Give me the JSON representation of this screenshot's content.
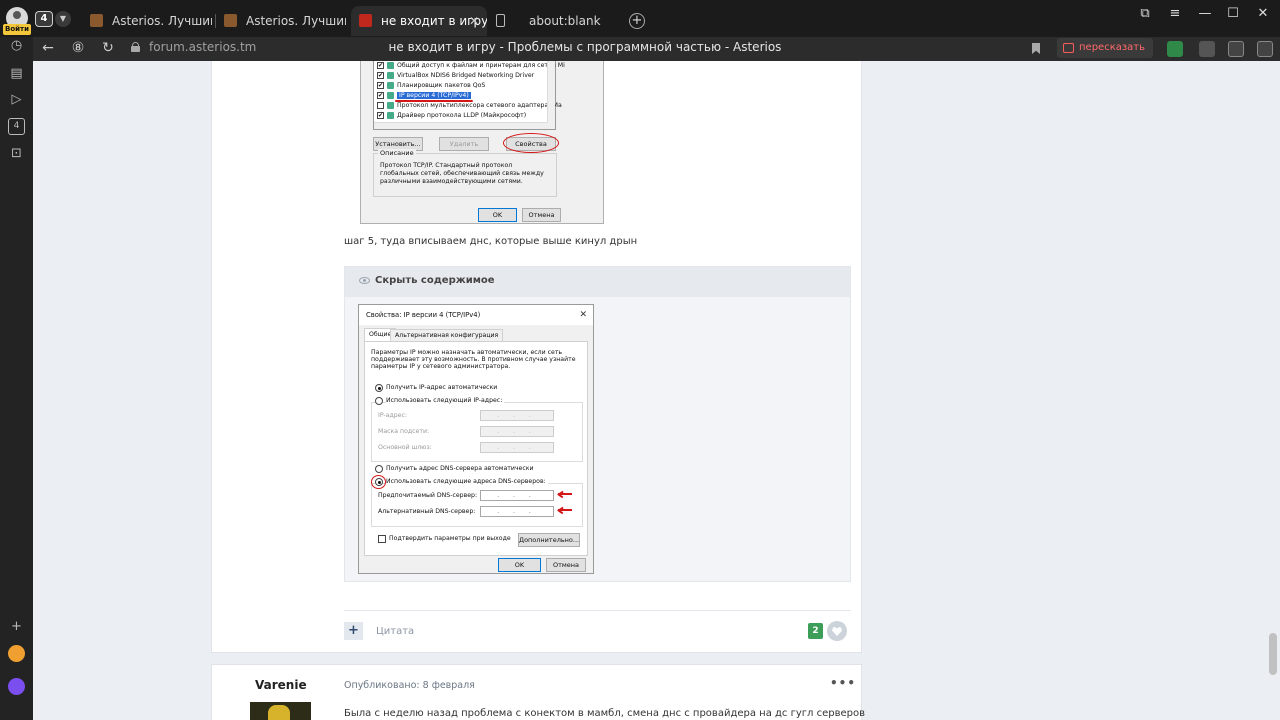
{
  "browser": {
    "login_badge": "Войти",
    "tab_count": "4",
    "tabs": [
      {
        "label": "Asterios. Лучший игровой"
      },
      {
        "label": "Asterios. Лучший игровой"
      },
      {
        "label": "не входит в игру - Проб"
      },
      {
        "label": "about:blank"
      }
    ],
    "url": "forum.asterios.tm",
    "page_title": "не входит в игру - Проблемы с программной частью - Asterios",
    "retell_label": "пересказать",
    "accent_color": "#d51616"
  },
  "screenshot1": {
    "items": [
      {
        "label": "Общий доступ к файлам и принтерам для сетей Mi",
        "checked": true
      },
      {
        "label": "VirtualBox NDIS6 Bridged Networking Driver",
        "checked": true
      },
      {
        "label": "Планировщик пакетов QoS",
        "checked": true
      },
      {
        "label": "IP версии 4 (TCP/IPv4)",
        "checked": true
      },
      {
        "label": "Протокол мультиплексора сетевого адаптера (Ma",
        "checked": false
      },
      {
        "label": "Драйвер протокола LLDP (Майкрософт)",
        "checked": true
      }
    ],
    "install_button": "Установить...",
    "remove_button": "Удалить",
    "properties_button": "Свойства",
    "description_caption": "Описание",
    "description_text": "Протокол TCP/IP. Стандартный протокол глобальных сетей, обеспечивающий связь между различными взаимодействующими сетями.",
    "ok_button": "OK",
    "cancel_button": "Отмена"
  },
  "post": {
    "text": "шаг 5, туда вписываем днс, которые выше кинул дрын",
    "spoiler_title": "Скрыть содержимое",
    "quote_label": "Цитата",
    "reputation": "2"
  },
  "screenshot2": {
    "title": "Свойства: IP версии 4 (TCP/IPv4)",
    "tab_general": "Общие",
    "tab_alt": "Альтернативная конфигурация",
    "intro": "Параметры IP можно назначать автоматически, если сеть поддерживает эту возможность. В противном случае узнайте параметры IP у сетевого администратора.",
    "auto_ip": "Получить IP-адрес автоматически",
    "manual_ip": "Использовать следующий IP-адрес:",
    "ip_address": "IP-адрес:",
    "subnet_mask": "Маска подсети:",
    "gateway": "Основной шлюз:",
    "auto_dns": "Получить адрес DNS-сервера автоматически",
    "manual_dns": "Использовать следующие адреса DNS-серверов:",
    "preferred_dns": "Предпочитаемый DNS-сервер:",
    "alternate_dns": "Альтернативный DNS-сервер:",
    "ip_placeholder": ". . .",
    "validate": "Подтвердить параметры при выходе",
    "advanced_button": "Дополнительно...",
    "ok_button": "OK",
    "cancel_button": "Отмена"
  },
  "next_post": {
    "author": "Varenie",
    "meta": "Опубликовано: 8 февраля",
    "menu": "•••",
    "text": "Была с неделю назад проблема с конектом в мамбл, смена днс с провайдера на дс гугл серверов"
  }
}
